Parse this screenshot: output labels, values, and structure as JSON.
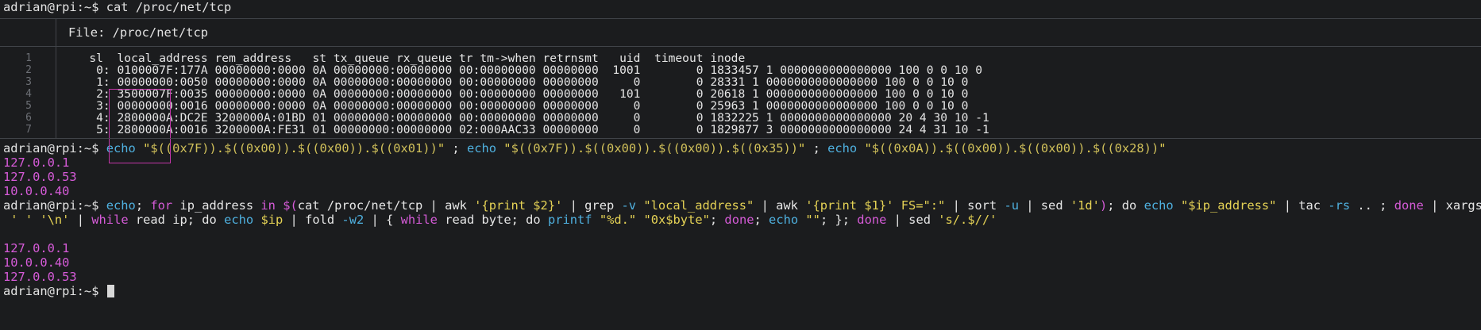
{
  "prompt": "adrian@rpi:~$",
  "cmd1": "cat /proc/net/tcp",
  "viewer": {
    "file_label": "File: /proc/net/tcp",
    "line_numbers": [
      "1",
      "2",
      "3",
      "4",
      "5",
      "6",
      "7"
    ],
    "lines": [
      "   sl  local_address rem_address   st tx_queue rx_queue tr tm->when retrnsmt   uid  timeout inode",
      "    0: 0100007F:177A 00000000:0000 0A 00000000:00000000 00:00000000 00000000  1001        0 1833457 1 0000000000000000 100 0 0 10 0",
      "    1: 00000000:0050 00000000:0000 0A 00000000:00000000 00:00000000 00000000     0        0 28331 1 0000000000000000 100 0 0 10 0",
      "    2: 3500007F:0035 00000000:0000 0A 00000000:00000000 00:00000000 00000000   101        0 20618 1 0000000000000000 100 0 0 10 0",
      "    3: 00000000:0016 00000000:0000 0A 00000000:00000000 00:00000000 00000000     0        0 25963 1 0000000000000000 100 0 0 10 0",
      "    4: 2800000A:DC2E 3200000A:01BD 01 00000000:00000000 00:00000000 00000000     0        0 1832225 1 0000000000000000 20 4 30 10 -1",
      "    5: 2800000A:0016 3200000A:FE31 01 00000000:00000000 02:000AAC33 00000000     0        0 1829877 3 0000000000000000 24 4 31 10 -1"
    ]
  },
  "cmd2": [
    {
      "t": "echo",
      "c": "cyan"
    },
    {
      "t": " \"",
      "c": "yellow"
    },
    {
      "t": "$((0x7F))",
      "c": "sub"
    },
    {
      "t": ".",
      "c": "yellow"
    },
    {
      "t": "$((0x00))",
      "c": "sub"
    },
    {
      "t": ".",
      "c": "yellow"
    },
    {
      "t": "$((0x00))",
      "c": "sub"
    },
    {
      "t": ".",
      "c": "yellow"
    },
    {
      "t": "$((0x01))",
      "c": "sub"
    },
    {
      "t": "\"",
      "c": "yellow"
    },
    {
      "t": " ; ",
      "c": "white"
    },
    {
      "t": "echo",
      "c": "cyan"
    },
    {
      "t": " \"",
      "c": "yellow"
    },
    {
      "t": "$((0x7F))",
      "c": "sub"
    },
    {
      "t": ".",
      "c": "yellow"
    },
    {
      "t": "$((0x00))",
      "c": "sub"
    },
    {
      "t": ".",
      "c": "yellow"
    },
    {
      "t": "$((0x00))",
      "c": "sub"
    },
    {
      "t": ".",
      "c": "yellow"
    },
    {
      "t": "$((0x35))",
      "c": "sub"
    },
    {
      "t": "\"",
      "c": "yellow"
    },
    {
      "t": " ; ",
      "c": "white"
    },
    {
      "t": "echo",
      "c": "cyan"
    },
    {
      "t": " \"",
      "c": "yellow"
    },
    {
      "t": "$((0x0A))",
      "c": "sub"
    },
    {
      "t": ".",
      "c": "yellow"
    },
    {
      "t": "$((0x00))",
      "c": "sub"
    },
    {
      "t": ".",
      "c": "yellow"
    },
    {
      "t": "$((0x00))",
      "c": "sub"
    },
    {
      "t": ".",
      "c": "yellow"
    },
    {
      "t": "$((0x28))",
      "c": "sub"
    },
    {
      "t": "\"",
      "c": "yellow"
    }
  ],
  "out2": [
    "127.0.0.1",
    "127.0.0.53",
    "10.0.0.40"
  ],
  "cmd3_line1": [
    {
      "t": "echo",
      "c": "cyan"
    },
    {
      "t": "; ",
      "c": "white"
    },
    {
      "t": "for",
      "c": "magenta"
    },
    {
      "t": " ip_address ",
      "c": "white"
    },
    {
      "t": "in",
      "c": "magenta"
    },
    {
      "t": " ",
      "c": "white"
    },
    {
      "t": "$(",
      "c": "magenta"
    },
    {
      "t": "cat /proc/net/tcp | awk ",
      "c": "white"
    },
    {
      "t": "'{print $2}'",
      "c": "yellow"
    },
    {
      "t": " | grep ",
      "c": "white"
    },
    {
      "t": "-v",
      "c": "cyan"
    },
    {
      "t": " ",
      "c": "white"
    },
    {
      "t": "\"local_address\"",
      "c": "yellow"
    },
    {
      "t": " | awk ",
      "c": "white"
    },
    {
      "t": "'{print $1}'",
      "c": "yellow"
    },
    {
      "t": " ",
      "c": "white"
    },
    {
      "t": "FS=\":\"",
      "c": "yellow"
    },
    {
      "t": " | sort ",
      "c": "white"
    },
    {
      "t": "-u",
      "c": "cyan"
    },
    {
      "t": " | sed ",
      "c": "white"
    },
    {
      "t": "'1d'",
      "c": "yellow"
    },
    {
      "t": ")",
      "c": "magenta"
    },
    {
      "t": "; ",
      "c": "white"
    },
    {
      "t": "do",
      "c": "white"
    },
    {
      "t": " ",
      "c": "white"
    },
    {
      "t": "echo",
      "c": "cyan"
    },
    {
      "t": " ",
      "c": "white"
    },
    {
      "t": "\"$ip_address\"",
      "c": "yellow"
    },
    {
      "t": " | tac ",
      "c": "white"
    },
    {
      "t": "-rs",
      "c": "cyan"
    },
    {
      "t": " .. ; ",
      "c": "white"
    },
    {
      "t": "done",
      "c": "magenta"
    },
    {
      "t": " | xargs | tr",
      "c": "white"
    }
  ],
  "cmd3_line2": [
    {
      "t": " ",
      "c": "white"
    },
    {
      "t": "' '",
      "c": "yellow"
    },
    {
      "t": " ",
      "c": "white"
    },
    {
      "t": "'\\n'",
      "c": "yellow"
    },
    {
      "t": " | ",
      "c": "white"
    },
    {
      "t": "while",
      "c": "magenta"
    },
    {
      "t": " read ip; ",
      "c": "white"
    },
    {
      "t": "do",
      "c": "white"
    },
    {
      "t": " ",
      "c": "white"
    },
    {
      "t": "echo",
      "c": "cyan"
    },
    {
      "t": " ",
      "c": "white"
    },
    {
      "t": "$ip",
      "c": "yellow"
    },
    {
      "t": " | fold ",
      "c": "white"
    },
    {
      "t": "-w2",
      "c": "cyan"
    },
    {
      "t": " | { ",
      "c": "white"
    },
    {
      "t": "while",
      "c": "magenta"
    },
    {
      "t": " read byte; ",
      "c": "white"
    },
    {
      "t": "do",
      "c": "white"
    },
    {
      "t": " ",
      "c": "white"
    },
    {
      "t": "printf",
      "c": "cyan"
    },
    {
      "t": " ",
      "c": "white"
    },
    {
      "t": "\"%d.\"",
      "c": "yellow"
    },
    {
      "t": " ",
      "c": "white"
    },
    {
      "t": "\"0x$byte\"",
      "c": "yellow"
    },
    {
      "t": "; ",
      "c": "white"
    },
    {
      "t": "done",
      "c": "magenta"
    },
    {
      "t": "; ",
      "c": "white"
    },
    {
      "t": "echo",
      "c": "cyan"
    },
    {
      "t": " ",
      "c": "white"
    },
    {
      "t": "\"\"",
      "c": "yellow"
    },
    {
      "t": "; }; ",
      "c": "white"
    },
    {
      "t": "done",
      "c": "magenta"
    },
    {
      "t": " | sed ",
      "c": "white"
    },
    {
      "t": "'s/.$//'",
      "c": "yellow"
    }
  ],
  "out3": [
    "127.0.0.1",
    "10.0.0.40",
    "127.0.0.53"
  ],
  "colors": {
    "background": "#1b1c1e",
    "foreground": "#e3e3e3",
    "magenta": "#d65bd8",
    "cyan": "#4fb1e0",
    "yellow": "#e5d255",
    "highlight_box": "#c236a8"
  }
}
